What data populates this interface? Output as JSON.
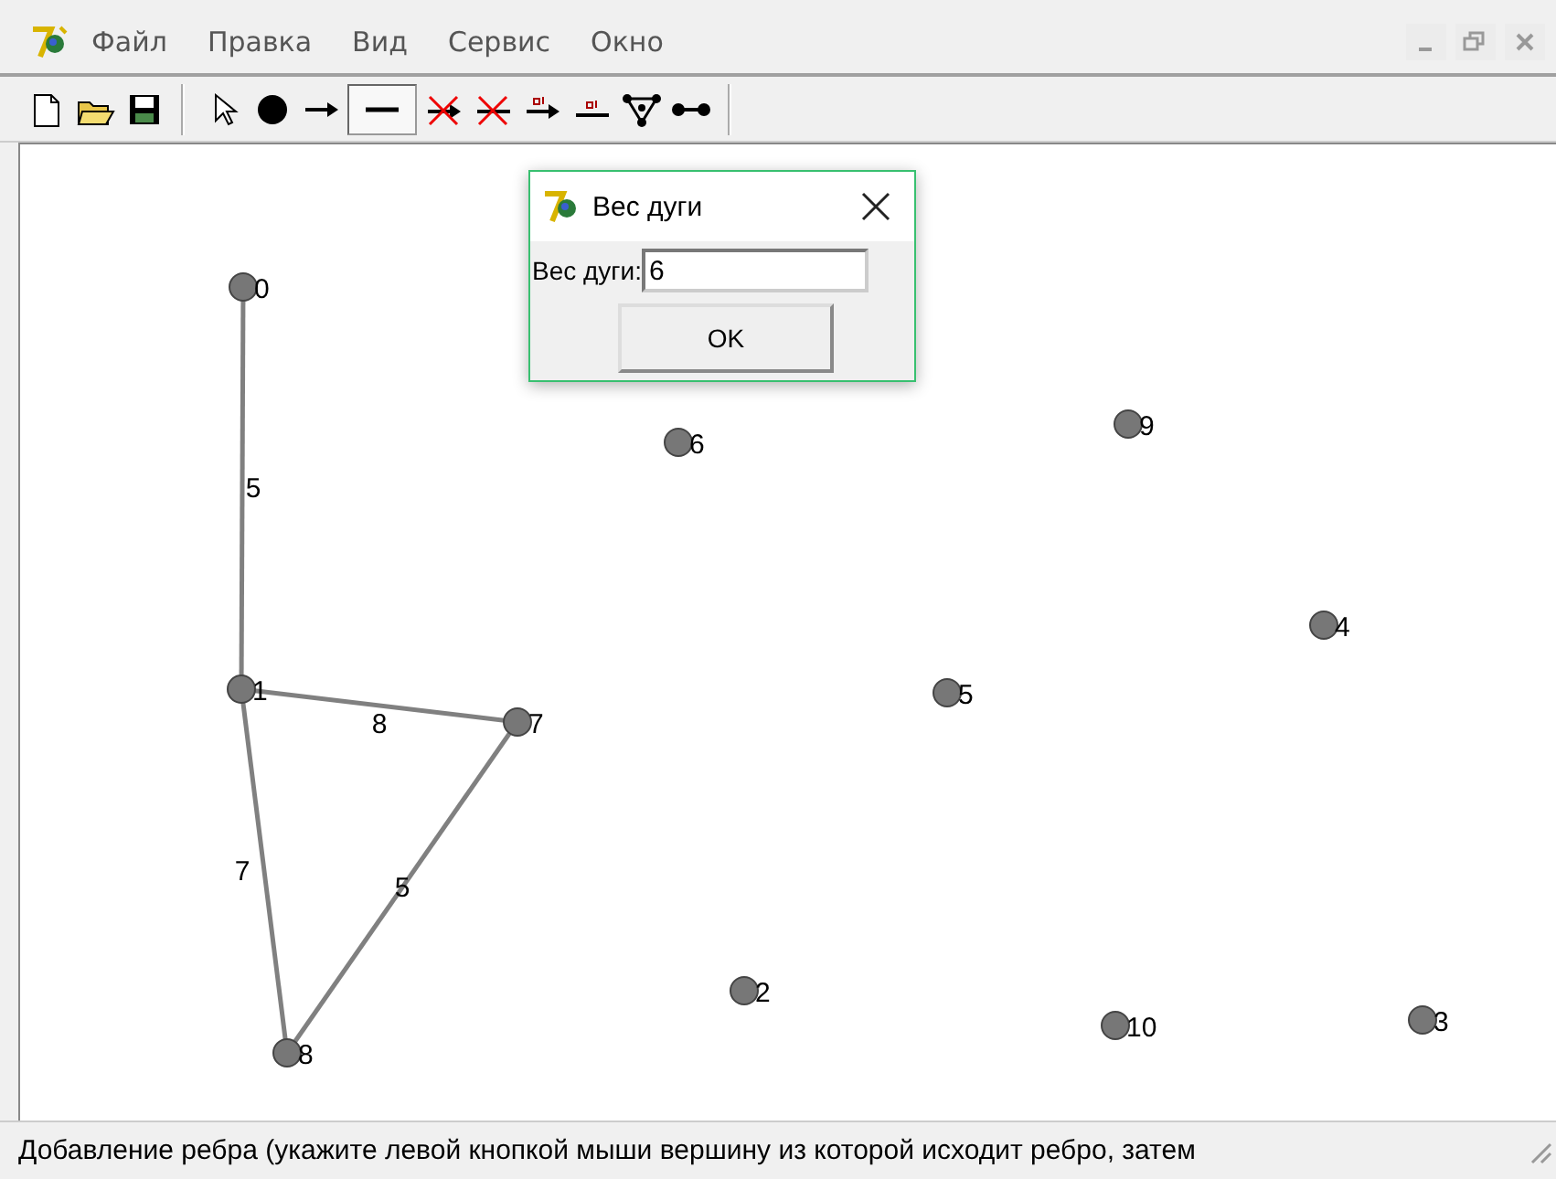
{
  "menu": [
    "Файл",
    "Правка",
    "Вид",
    "Сервис",
    "Окно"
  ],
  "toolbar": [
    {
      "kind": "new",
      "selected": false
    },
    {
      "kind": "open",
      "selected": false
    },
    {
      "kind": "save",
      "selected": false
    },
    {
      "kind": "pointer",
      "selected": false
    },
    {
      "kind": "vertex",
      "selected": false
    },
    {
      "kind": "arc",
      "selected": false
    },
    {
      "kind": "edge",
      "selected": true
    },
    {
      "kind": "delete-arc",
      "selected": false
    },
    {
      "kind": "delete-edge",
      "selected": false
    },
    {
      "kind": "weighted-arc",
      "selected": false
    },
    {
      "kind": "weighted-edge",
      "selected": false
    },
    {
      "kind": "graph",
      "selected": false
    },
    {
      "kind": "path",
      "selected": false
    }
  ],
  "graph": {
    "nodes": [
      "0",
      "1",
      "2",
      "3",
      "4",
      "5",
      "6",
      "7",
      "8",
      "9",
      "10"
    ],
    "edges": [
      "5",
      "8",
      "7",
      "5"
    ]
  },
  "dialog": {
    "title": "Вес дуги",
    "field_label": "Вес дуги:",
    "value": "6",
    "button": "OK"
  },
  "status_bar": "Добавление ребра (укажите левой кнопкой мыши вершину из которой исходит ребро, затем"
}
